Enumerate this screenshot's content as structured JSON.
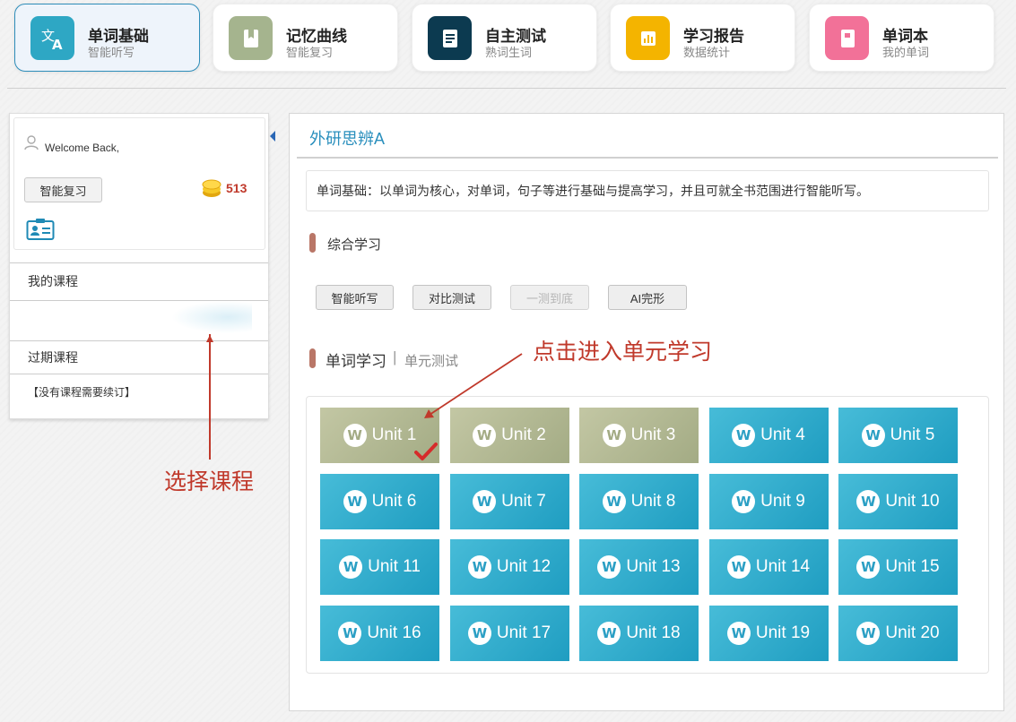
{
  "nav": {
    "items": [
      {
        "title": "单词基础",
        "sub": "智能听写",
        "color": "#2ea7c4",
        "icon": "translate-icon",
        "active": true
      },
      {
        "title": "记忆曲线",
        "sub": "智能复习",
        "color": "#a5b48e",
        "icon": "bookmark-icon",
        "active": false
      },
      {
        "title": "自主测试",
        "sub": "熟词生词",
        "color": "#0c3a50",
        "icon": "document-icon",
        "active": false
      },
      {
        "title": "学习报告",
        "sub": "数据统计",
        "color": "#f4b400",
        "icon": "bar-chart-icon",
        "active": false
      },
      {
        "title": "单词本",
        "sub": "我的单词",
        "color": "#f27198",
        "icon": "notebook-icon",
        "active": false
      }
    ]
  },
  "sidebar": {
    "welcome": "Welcome Back,",
    "review_btn": "智能复习",
    "coins": "513",
    "my_courses": "我的课程",
    "expired_courses": "过期课程",
    "no_renew": "【没有课程需要续订】"
  },
  "main": {
    "course_title": "外研思辨A",
    "description": "单词基础：以单词为核心，对单词，句子等进行基础与提高学习，并且可就全书范围进行智能听写。",
    "section1": "综合学习",
    "modes": [
      {
        "label": "智能听写",
        "disabled": false
      },
      {
        "label": "对比测试",
        "disabled": false
      },
      {
        "label": "一测到底",
        "disabled": true
      },
      {
        "label": "AI完形",
        "disabled": false
      }
    ],
    "section2": "单词学习",
    "section2_sep": "|",
    "section2_tab": "单元测试",
    "unit_badge": "W",
    "units": [
      {
        "label": "Unit 1",
        "done": true
      },
      {
        "label": "Unit 2",
        "done": true
      },
      {
        "label": "Unit 3",
        "done": true
      },
      {
        "label": "Unit 4",
        "done": false
      },
      {
        "label": "Unit 5",
        "done": false
      },
      {
        "label": "Unit 6",
        "done": false
      },
      {
        "label": "Unit 7",
        "done": false
      },
      {
        "label": "Unit 8",
        "done": false
      },
      {
        "label": "Unit 9",
        "done": false
      },
      {
        "label": "Unit 10",
        "done": false
      },
      {
        "label": "Unit 11",
        "done": false
      },
      {
        "label": "Unit 12",
        "done": false
      },
      {
        "label": "Unit 13",
        "done": false
      },
      {
        "label": "Unit 14",
        "done": false
      },
      {
        "label": "Unit 15",
        "done": false
      },
      {
        "label": "Unit 16",
        "done": false
      },
      {
        "label": "Unit 17",
        "done": false
      },
      {
        "label": "Unit 18",
        "done": false
      },
      {
        "label": "Unit 19",
        "done": false
      },
      {
        "label": "Unit 20",
        "done": false
      }
    ]
  },
  "annotations": {
    "select_course": "选择课程",
    "enter_unit": "点击进入单元学习",
    "color": "#c0392b"
  }
}
